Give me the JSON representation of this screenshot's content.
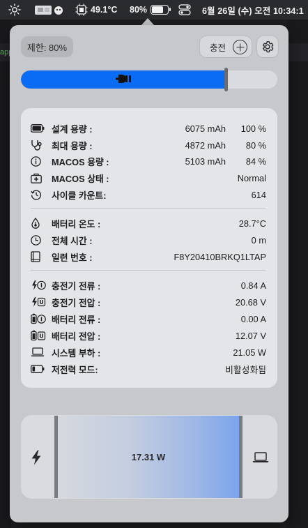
{
  "menubar": {
    "temperature": "49.1°C",
    "battery_percent": "80%",
    "datetime": "6월 26일 (수) 오전 10:34:1",
    "battery_level": 0.8
  },
  "background": {
    "editor_fragment": "app"
  },
  "popover": {
    "limit_label": "제한: 80%",
    "charge_label": "충전",
    "limit_value": 0.8
  },
  "info": {
    "rows": [
      {
        "label": "설계 용량 :",
        "value": "6075 mAh",
        "pct": "100 %"
      },
      {
        "label": "최대 용량 :",
        "value": "4872 mAh",
        "pct": "80 %"
      },
      {
        "label": "MACOS 용량 :",
        "value": "5103 mAh",
        "pct": "84 %"
      },
      {
        "label": "MACOS 상태 :",
        "value": "Normal"
      },
      {
        "label": "사이클 카운트:",
        "value": "614"
      },
      {
        "label": "배터리 온도 :",
        "value": "28.7°C"
      },
      {
        "label": "전체 시간 :",
        "value": "0 m"
      },
      {
        "label": "일련 번호 :",
        "value": "F8Y20410BRKQ1LTAP"
      },
      {
        "label": "충전기 전류 :",
        "value": "0.84 A"
      },
      {
        "label": "충전기 전압 :",
        "value": "20.68 V"
      },
      {
        "label": "배터리 전류 :",
        "value": "0.00 A"
      },
      {
        "label": "배터리 전압 :",
        "value": "12.07 V"
      },
      {
        "label": "시스템 부하 :",
        "value": "21.05 W"
      },
      {
        "label": "저전력 모드:",
        "value": "비활성화됨"
      }
    ],
    "icon_badges": {
      "current": "I",
      "voltage": "U"
    }
  },
  "flow": {
    "power": "17.31 W"
  },
  "icons": {
    "menubar": [
      "sun-icon",
      "app-icon",
      "cpu-icon",
      "battery-icon",
      "control-center-icon"
    ],
    "rows": [
      "battery-icon",
      "stethoscope-icon",
      "info-icon",
      "medical-case-icon",
      "history-icon",
      "thermometer-drop-icon",
      "clock-icon",
      "book-icon",
      "charger-current-icon",
      "charger-voltage-icon",
      "battery-current-icon",
      "battery-voltage-icon",
      "laptop-icon",
      "low-power-battery-icon"
    ]
  },
  "colors": {
    "accent": "#0a6cf5",
    "popover_bg": "#c6c8cb",
    "card_bg": "#e3e5e8"
  }
}
